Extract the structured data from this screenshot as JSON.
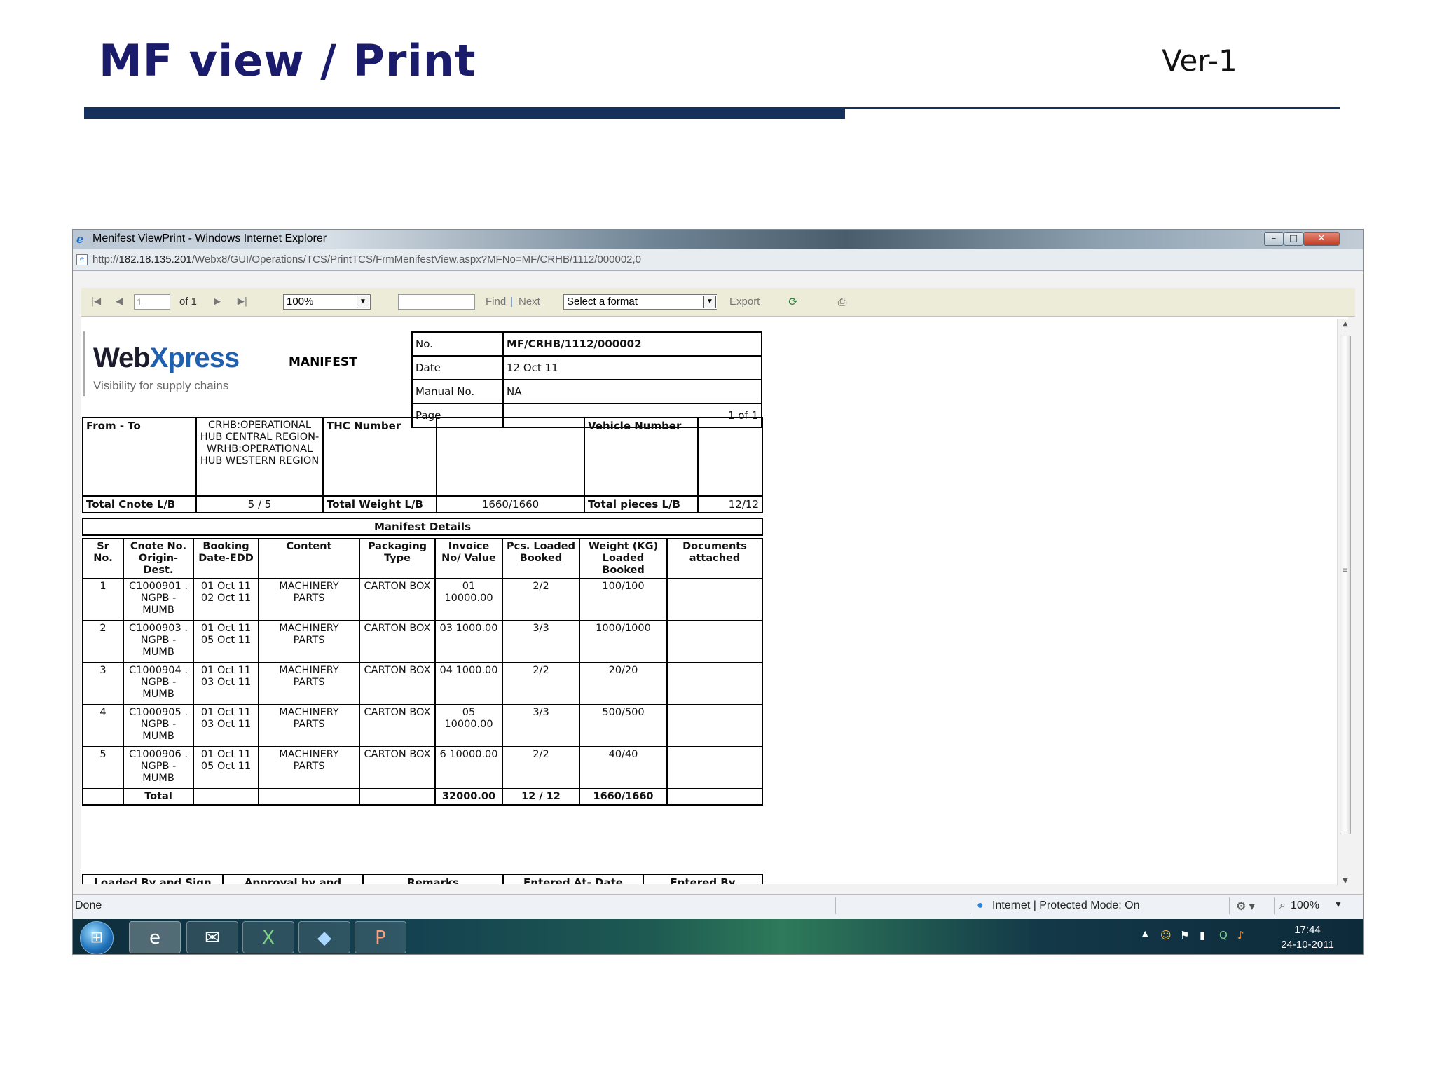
{
  "slide": {
    "title": "MF view / Print",
    "version": "Ver-1"
  },
  "window": {
    "title": "Menifest ViewPrint - Windows Internet Explorer",
    "url_prefix": "http://",
    "url_host": "182.18.135.201",
    "url_path": "/Webx8/GUI/Operations/TCS/PrintTCS/FrmMenifestView.aspx?MFNo=MF/CRHB/1112/000002,0",
    "buttons": {
      "minimize": "–",
      "maximize": "□",
      "close": "✕"
    }
  },
  "toolbar": {
    "page_input": "1",
    "of_label": "of 1",
    "zoom": "100%",
    "find_input": "",
    "find_label": "Find",
    "sep": "|",
    "next_label": "Next",
    "format_select": "Select a format",
    "export_label": "Export"
  },
  "report": {
    "logo_main": "Web",
    "logo_accent": "Xpress",
    "logo_tagline": "Visibility for supply chains",
    "doc_type": "MANIFEST",
    "header": [
      {
        "label": "No.",
        "value": "MF/CRHB/1112/000002"
      },
      {
        "label": "Date",
        "value": "12 Oct 11"
      },
      {
        "label": "Manual No.",
        "value": "NA"
      },
      {
        "label": "Page",
        "value": "1 of 1"
      }
    ],
    "route": {
      "from_to_label": "From - To",
      "from_to_value": "CRHB:OPERATIONAL HUB CENTRAL REGION-WRHB:OPERATIONAL HUB WESTERN REGION",
      "thc_label": "THC Number",
      "thc_value": "",
      "vehicle_label": "Vehicle Number",
      "vehicle_value": "",
      "total_cnote_label": "Total Cnote L/B",
      "total_cnote_value": "5 / 5",
      "total_weight_label": "Total Weight L/B",
      "total_weight_value": "1660/1660",
      "total_pieces_label": "Total pieces L/B",
      "total_pieces_value": "12/12"
    },
    "details_title": "Manifest Details",
    "columns": [
      "Sr No.",
      "Cnote No. Origin-Dest.",
      "Booking Date-EDD",
      "Content",
      "Packaging Type",
      "Invoice No/ Value",
      "Pcs. Loaded Booked",
      "Weight (KG) Loaded Booked",
      "Documents attached"
    ],
    "rows": [
      [
        "1",
        "C1000901 . NGPB - MUMB",
        "01 Oct 11 02 Oct 11",
        "MACHINERY PARTS",
        "CARTON BOX",
        "01 10000.00",
        "2/2",
        "100/100",
        ""
      ],
      [
        "2",
        "C1000903 . NGPB - MUMB",
        "01 Oct 11 05 Oct 11",
        "MACHINERY PARTS",
        "CARTON BOX",
        "03 1000.00",
        "3/3",
        "1000/1000",
        ""
      ],
      [
        "3",
        "C1000904 . NGPB - MUMB",
        "01 Oct 11 03 Oct 11",
        "MACHINERY PARTS",
        "CARTON BOX",
        "04 1000.00",
        "2/2",
        "20/20",
        ""
      ],
      [
        "4",
        "C1000905 . NGPB - MUMB",
        "01 Oct 11 03 Oct 11",
        "MACHINERY PARTS",
        "CARTON BOX",
        "05 10000.00",
        "3/3",
        "500/500",
        ""
      ],
      [
        "5",
        "C1000906 . NGPB - MUMB",
        "01 Oct 11 05 Oct 11",
        "MACHINERY PARTS",
        "CARTON BOX",
        "6 10000.00",
        "2/2",
        "40/40",
        ""
      ]
    ],
    "total": {
      "label": "Total",
      "invoice": "32000.00",
      "pcs": "12 / 12",
      "weight": "1660/1660"
    },
    "footer_cols": [
      "Loaded By and Sign",
      "Approval by and",
      "Remarks",
      "Entered At- Date",
      "Entered By"
    ]
  },
  "statusbar": {
    "left": "Done",
    "zone": "Internet | Protected Mode: On",
    "zoom": "100%"
  },
  "taskbar": {
    "time": "17:44",
    "date": "24-10-2011"
  }
}
